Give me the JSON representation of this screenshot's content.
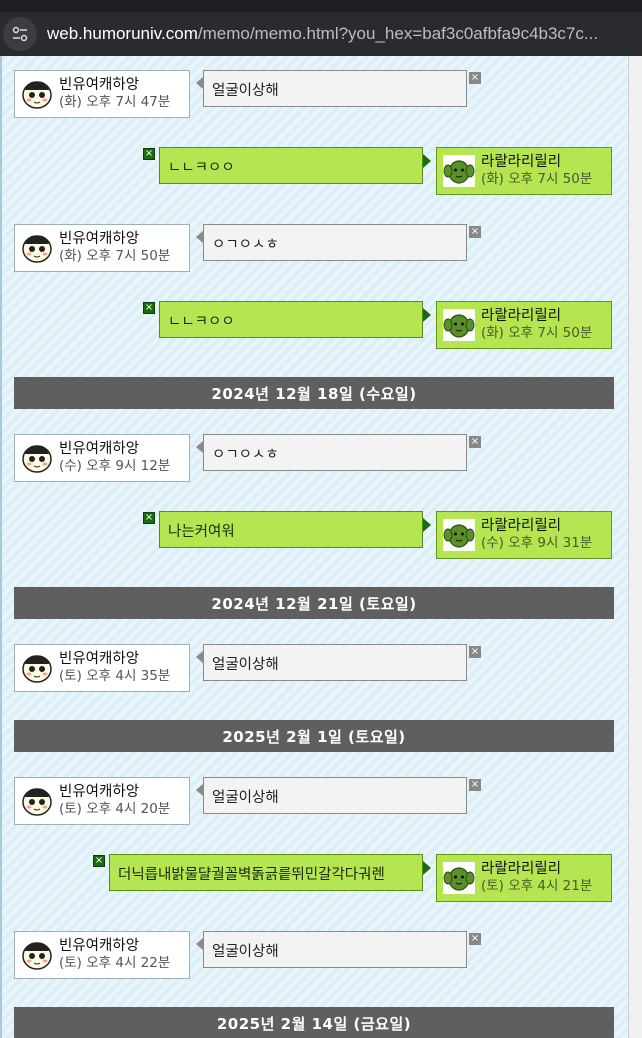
{
  "browser": {
    "url_host": "web.humoruniv.com",
    "url_rest": "/memo/memo.html?you_hex=baf3c0afbfa9c4b3c7c..."
  },
  "colors": {
    "friend_profile_bg": "#ffffff",
    "self_bubble_bg": "#b5e551",
    "date_bar_bg": "#5f5f5f"
  },
  "messages": [
    {
      "side": "left",
      "name": "빈유여캐하앙",
      "time": "(화) 오후 7시 47분",
      "text": "얼굴이상해",
      "avatar_icon": "crying-face-icon"
    },
    {
      "side": "right",
      "name": "라랄라리릴리",
      "time": "(화) 오후 7시 50분",
      "text": "ㄴㄴㅋㅇㅇ",
      "avatar_icon": "green-cactus-icon"
    },
    {
      "side": "left",
      "name": "빈유여캐하앙",
      "time": "(화) 오후 7시 50분",
      "text": "ㅇㄱㅇㅅㅎ",
      "avatar_icon": "crying-face-icon"
    },
    {
      "side": "right",
      "name": "라랄라리릴리",
      "time": "(화) 오후 7시 50분",
      "text": "ㄴㄴㅋㅇㅇ",
      "avatar_icon": "green-cactus-icon"
    },
    {
      "side": "left",
      "name": "빈유여캐하앙",
      "time": "(수) 오후 9시 12분",
      "text": "ㅇㄱㅇㅅㅎ",
      "avatar_icon": "crying-face-icon"
    },
    {
      "side": "right",
      "name": "라랄라리릴리",
      "time": "(수) 오후 9시 31분",
      "text": "나는커여워",
      "avatar_icon": "green-cactus-icon"
    },
    {
      "side": "left",
      "name": "빈유여캐하앙",
      "time": "(토) 오후 4시 35분",
      "text": "얼굴이상해",
      "avatar_icon": "crying-face-icon"
    },
    {
      "side": "left",
      "name": "빈유여캐하앙",
      "time": "(토) 오후 4시 20분",
      "text": "얼굴이상해",
      "avatar_icon": "crying-face-icon"
    },
    {
      "side": "right",
      "name": "라랄라리릴리",
      "time": "(토) 오후 4시 21분",
      "text": "더닉릅내밝물댤궐꼴벽돍긁릍뛰민갈각다궈렌",
      "avatar_icon": "green-cactus-icon"
    },
    {
      "side": "left",
      "name": "빈유여캐하앙",
      "time": "(토) 오후 4시 22분",
      "text": "얼굴이상해",
      "avatar_icon": "crying-face-icon"
    }
  ],
  "date_separators": [
    "2024년 12월 18일 (수요일)",
    "2024년 12월 21일 (토요일)",
    "2025년 2월 1일 (토요일)",
    "2025년 2월 14일 (금요일)"
  ],
  "delete_icon_glyph": "×"
}
